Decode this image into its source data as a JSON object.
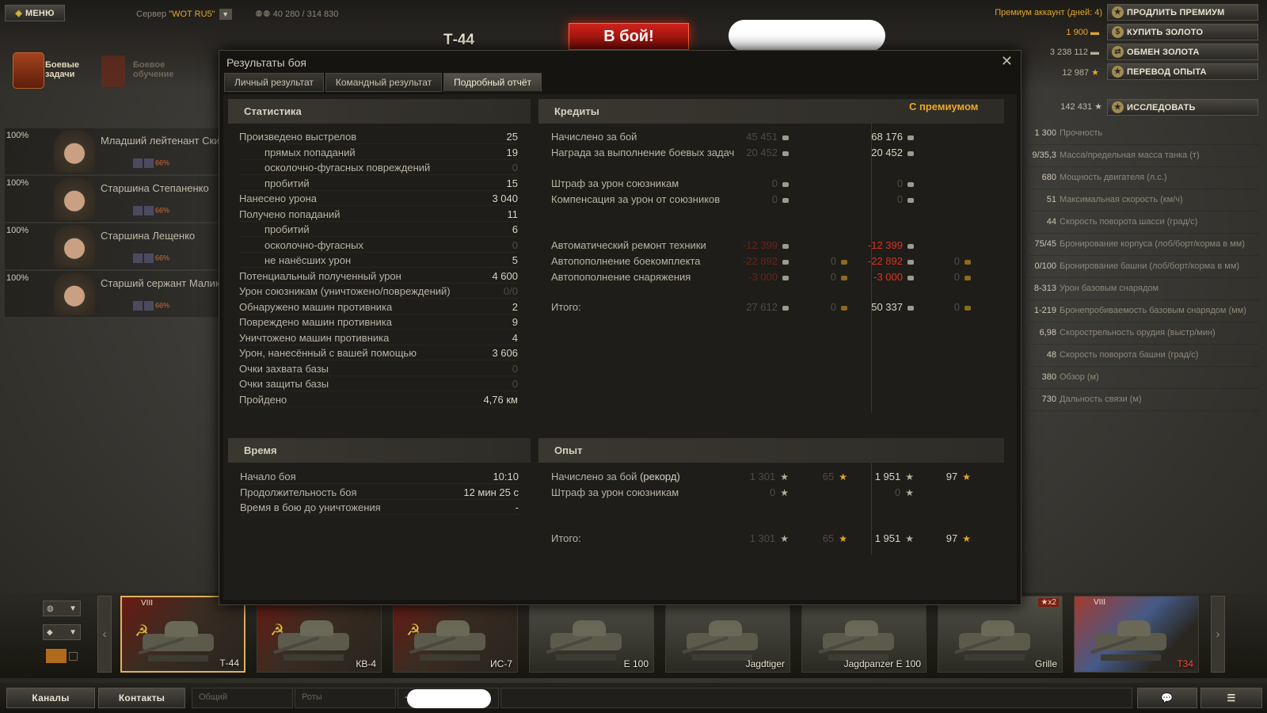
{
  "topbar": {
    "menu": "МЕНЮ",
    "server_label": "Сервер",
    "server_value": "\"WOT RU5\"",
    "online": "40 280 / 314 830",
    "tank_name": "Т-44",
    "battle_button": "В бой!",
    "premium_days": "Премиум аккаунт (дней: 4)",
    "gold": "1 900",
    "credits": "3 238 112",
    "free_xp": "12 987",
    "buttons": {
      "extend_premium": "ПРОДЛИТЬ ПРЕМИУМ",
      "buy_gold": "КУПИТЬ ЗОЛОТО",
      "exchange_gold": "ОБМЕН ЗОЛОТА",
      "convert_xp": "ПЕРЕВОД ОПЫТА",
      "research": "ИССЛЕДОВАТЬ"
    },
    "tank_xp": "142 431"
  },
  "left": {
    "quests": "Боевые\nзадачи",
    "training": "Боевое\nобучение",
    "crew": [
      {
        "pct": "100%",
        "name": "Младший лейтенант Скир",
        "skill": "66%"
      },
      {
        "pct": "100%",
        "name": "Старшина Степаненко",
        "skill": "66%"
      },
      {
        "pct": "100%",
        "name": "Старшина Лещенко",
        "skill": "66%"
      },
      {
        "pct": "100%",
        "name": "Старший сержант Малико",
        "skill": "66%"
      }
    ]
  },
  "params": [
    {
      "v": "1 300",
      "l": "Прочность"
    },
    {
      "v": "9/35,3",
      "l": "Масса/предельная масса танка (т)"
    },
    {
      "v": "680",
      "l": "Мощность двигателя (л.с.)"
    },
    {
      "v": "51",
      "l": "Максимальная скорость (км/ч)"
    },
    {
      "v": "44",
      "l": "Скорость поворота шасси (град/с)"
    },
    {
      "v": "75/45",
      "l": "Бронирование корпуса (лоб/борт/корма в мм)"
    },
    {
      "v": "0/100",
      "l": "Бронирование башни (лоб/борт/корма в мм)"
    },
    {
      "v": "8-313",
      "l": "Урон базовым снарядом"
    },
    {
      "v": "1-219",
      "l": "Бронепробиваемость базовым снарядом (мм)"
    },
    {
      "v": "6,98",
      "l": "Скорострельность орудия (выстр/мин)"
    },
    {
      "v": "48",
      "l": "Скорость поворота башни (град/с)"
    },
    {
      "v": "380",
      "l": "Обзор (м)"
    },
    {
      "v": "730",
      "l": "Дальность связи (м)"
    }
  ],
  "modal": {
    "title": "Результаты боя",
    "tabs": [
      "Личный результат",
      "Командный результат",
      "Подробный отчёт"
    ],
    "stats": {
      "header": "Статистика",
      "rows": [
        {
          "l": "Произведено выстрелов",
          "v": "25"
        },
        {
          "l": "прямых попаданий",
          "v": "19"
        },
        {
          "l": "осколочно-фугасных повреждений",
          "v": "0"
        },
        {
          "l": "пробитий",
          "v": "15"
        },
        {
          "l": "Нанесено урона",
          "v": "3 040"
        },
        {
          "l": "Получено попаданий",
          "v": "11"
        },
        {
          "l": "пробитий",
          "v": "6"
        },
        {
          "l": "осколочно-фугасных",
          "v": "0"
        },
        {
          "l": "не нанёсших урон",
          "v": "5"
        },
        {
          "l": "Потенциальный полученный урон",
          "v": "4 600"
        },
        {
          "l": "Урон союзникам (уничтожено/повреждений)",
          "v": "0/0"
        },
        {
          "l": "Обнаружено машин противника",
          "v": "2"
        },
        {
          "l": "Повреждено машин противника",
          "v": "9"
        },
        {
          "l": "Уничтожено машин противника",
          "v": "4"
        },
        {
          "l": "Урон, нанесённый с вашей помощью",
          "v": "3 606"
        },
        {
          "l": "Очки захвата базы",
          "v": "0"
        },
        {
          "l": "Очки защиты базы",
          "v": "0"
        },
        {
          "l": "Пройдено",
          "v": "4,76 км"
        }
      ]
    },
    "credits": {
      "header": "Кредиты",
      "premium_header": "С премиумом",
      "rows": [
        {
          "l": "Начислено за бой",
          "a": "45 451",
          "b": "",
          "c": "68 176",
          "d": ""
        },
        {
          "l": "Награда за выполнение боевых задач",
          "a": "20 452",
          "b": "",
          "c": "20 452",
          "d": ""
        },
        {
          "l": "Штраф за урон союзникам",
          "a": "0",
          "b": "",
          "c": "0",
          "d": ""
        },
        {
          "l": "Компенсация за урон от союзников",
          "a": "0",
          "b": "",
          "c": "0",
          "d": ""
        },
        {
          "l": "Автоматический ремонт техники",
          "a": "-12 399",
          "b": "",
          "c": "-12 399",
          "d": ""
        },
        {
          "l": "Автопополнение боекомплекта",
          "a": "-22 892",
          "b": "0",
          "c": "-22 892",
          "d": "0"
        },
        {
          "l": "Автопополнение снаряжения",
          "a": "-3 000",
          "b": "0",
          "c": "-3 000",
          "d": "0"
        },
        {
          "l": "Итого:",
          "a": "27 612",
          "b": "0",
          "c": "50 337",
          "d": "0"
        }
      ]
    },
    "time": {
      "header": "Время",
      "rows": [
        {
          "l": "Начало боя",
          "v": "10:10"
        },
        {
          "l": "Продолжительность боя",
          "v": "12 мин 25 с"
        },
        {
          "l": "Время в бою до уничтожения",
          "v": "-"
        }
      ]
    },
    "xp": {
      "header": "Опыт",
      "rows": [
        {
          "l": "Начислено за бой",
          "l2": "(рекорд)",
          "a": "1 301",
          "b": "65",
          "c": "1 951",
          "d": "97"
        },
        {
          "l": "Штраф за урон союзникам",
          "l2": "",
          "a": "0",
          "b": "",
          "c": "0",
          "d": ""
        },
        {
          "l": "Итого:",
          "l2": "",
          "a": "1 301",
          "b": "65",
          "c": "1 951",
          "d": "97"
        }
      ]
    }
  },
  "carousel": {
    "tanks": [
      {
        "name": "Т-44",
        "tier": "VIII"
      },
      {
        "name": "КВ-4",
        "tier": ""
      },
      {
        "name": "ИС-7",
        "tier": ""
      },
      {
        "name": "E 100",
        "tier": ""
      },
      {
        "name": "Jagdtiger",
        "tier": ""
      },
      {
        "name": "Jagdpanzer E 100",
        "tier": ""
      },
      {
        "name": "Grille",
        "tier": "",
        "badge": "★x2"
      },
      {
        "name": "T34",
        "tier": "VIII"
      }
    ]
  },
  "bottom": {
    "channels": "Каналы",
    "contacts": "Контакты",
    "chat_general": "Общий",
    "chat_company": "Роты",
    "chat_extra": "--"
  }
}
